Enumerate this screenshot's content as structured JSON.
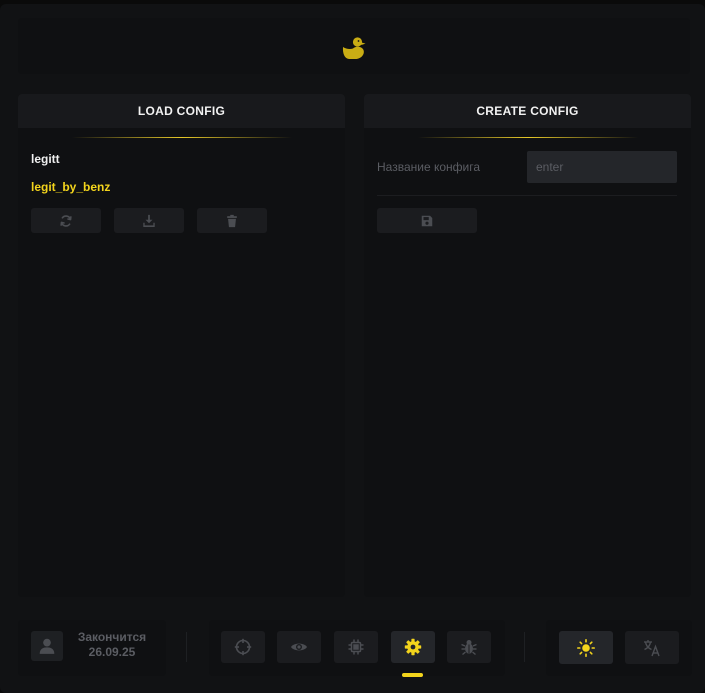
{
  "theme": {
    "accent": "#f3d41c",
    "background": "#111214",
    "panel": "#0f1012",
    "muted": "#5b5d63"
  },
  "header": {
    "logo_icon": "duck-icon"
  },
  "load_panel": {
    "title": "LOAD CONFIG",
    "configs": [
      {
        "name": "legitt",
        "selected": false
      },
      {
        "name": "legit_by_benz",
        "selected": true
      }
    ],
    "actions": [
      {
        "icon": "refresh-icon"
      },
      {
        "icon": "download-icon"
      },
      {
        "icon": "trash-icon"
      }
    ]
  },
  "create_panel": {
    "title": "CREATE CONFIG",
    "name_label": "Название конфига",
    "name_input": {
      "value": "",
      "placeholder": "enter"
    },
    "save_icon": "save-icon"
  },
  "footer": {
    "user_icon": "user-icon",
    "expires_label": "Закончится",
    "expires_date": "26.09.25",
    "nav": [
      {
        "icon": "crosshair-icon",
        "active": false
      },
      {
        "icon": "eye-icon",
        "active": false
      },
      {
        "icon": "chip-icon",
        "active": false
      },
      {
        "icon": "gear-icon",
        "active": true
      },
      {
        "icon": "bug-icon",
        "active": false
      }
    ],
    "settings": [
      {
        "icon": "sun-icon",
        "active": true
      },
      {
        "icon": "translate-icon",
        "active": false
      }
    ]
  }
}
